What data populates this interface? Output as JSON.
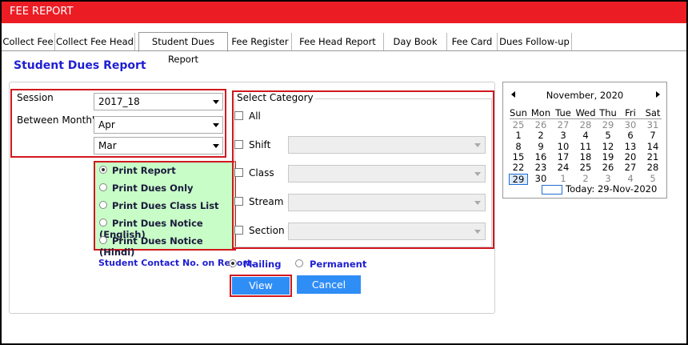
{
  "window": {
    "title": "FEE REPORT"
  },
  "tabs": [
    {
      "label": "Collect Fee"
    },
    {
      "label": "Collect Fee Head"
    },
    {
      "label": "Student Dues Report"
    },
    {
      "label": "Fee Register"
    },
    {
      "label": "Fee Head Report"
    },
    {
      "label": "Day Book"
    },
    {
      "label": "Fee Card"
    },
    {
      "label": "Dues Follow-up"
    }
  ],
  "page_title": "Student Dues Report",
  "filters": {
    "session_label": "Session",
    "session_value": "2017_18",
    "between_label": "Between Month's",
    "from_month": "Apr",
    "to_month": "Mar"
  },
  "report_options": [
    {
      "label": "Print Report",
      "selected": true
    },
    {
      "label": "Print Dues Only",
      "selected": false
    },
    {
      "label": "Print Dues Class List",
      "selected": false
    },
    {
      "label": "Print Dues Notice (English)",
      "selected": false
    },
    {
      "label": "Print Dues Notice (Hindi)",
      "selected": false
    }
  ],
  "category": {
    "title": "Select Category",
    "all_label": "All",
    "items": [
      {
        "label": "Shift",
        "value": ""
      },
      {
        "label": "Class",
        "value": ""
      },
      {
        "label": "Stream",
        "value": ""
      },
      {
        "label": "Section",
        "value": ""
      }
    ]
  },
  "contact": {
    "label": "Student Contact No. on Report.",
    "mailing_label": "Mailing",
    "permanent_label": "Permanent",
    "selected": "Mailing"
  },
  "buttons": {
    "view_label": "View",
    "cancel_label": "Cancel"
  },
  "calendar": {
    "month_label": "November, 2020",
    "days_of_week": [
      "Sun",
      "Mon",
      "Tue",
      "Wed",
      "Thu",
      "Fri",
      "Sat"
    ],
    "weeks": [
      [
        "25",
        "26",
        "27",
        "28",
        "29",
        "30",
        "31"
      ],
      [
        "1",
        "2",
        "3",
        "4",
        "5",
        "6",
        "7"
      ],
      [
        "8",
        "9",
        "10",
        "11",
        "12",
        "13",
        "14"
      ],
      [
        "15",
        "16",
        "17",
        "18",
        "19",
        "20",
        "21"
      ],
      [
        "22",
        "23",
        "24",
        "25",
        "26",
        "27",
        "28"
      ],
      [
        "29",
        "30",
        "1",
        "2",
        "3",
        "4",
        "5"
      ]
    ],
    "today_label": "Today: 29-Nov-2020"
  },
  "colors": {
    "title_bar": "#ec1c24",
    "accent": "#1f1fd2",
    "button": "#2f8df6",
    "highlight": "#d0191e",
    "radio_bg": "#c8fdc8"
  }
}
